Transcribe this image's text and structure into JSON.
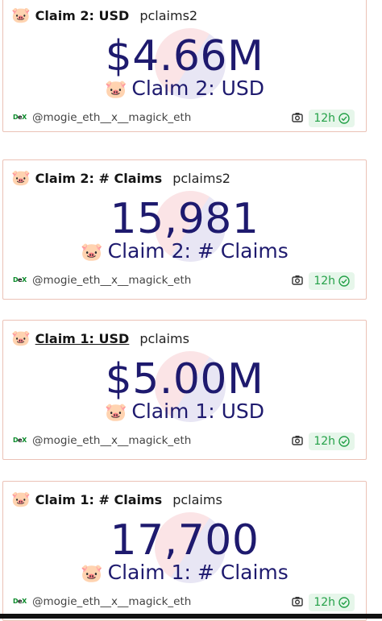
{
  "cards": [
    {
      "title": "Claim 2: USD",
      "handle": "pclaims2",
      "value": "$4.66M",
      "subtitle": "Claim 2: USD",
      "author": "@mogie_eth__x__magick_eth",
      "time": "12h",
      "logo": "DEX"
    },
    {
      "title": "Claim 2: # Claims",
      "handle": "pclaims2",
      "value": "15,981",
      "subtitle": "Claim 2: # Claims",
      "author": "@mogie_eth__x__magick_eth",
      "time": "12h",
      "logo": "DEX"
    },
    {
      "title": "Claim 1: USD",
      "handle": "pclaims",
      "value": "$5.00M",
      "subtitle": "Claim 1: USD",
      "author": "@mogie_eth__x__magick_eth",
      "time": "12h",
      "logo": "DEX"
    },
    {
      "title": "Claim 1: # Claims",
      "handle": "pclaims",
      "value": "17,700",
      "subtitle": "Claim 1: # Claims",
      "author": "@mogie_eth__x__magick_eth",
      "time": "12h",
      "logo": "DEX"
    }
  ],
  "icons": {
    "pig": "🐷",
    "camera": "camera-icon",
    "verified": "check-circle-icon"
  },
  "colors": {
    "value": "#1e1a6e",
    "border": "#ebc2b6",
    "time_bg": "#e6f6ea",
    "time_fg": "#24a148"
  }
}
